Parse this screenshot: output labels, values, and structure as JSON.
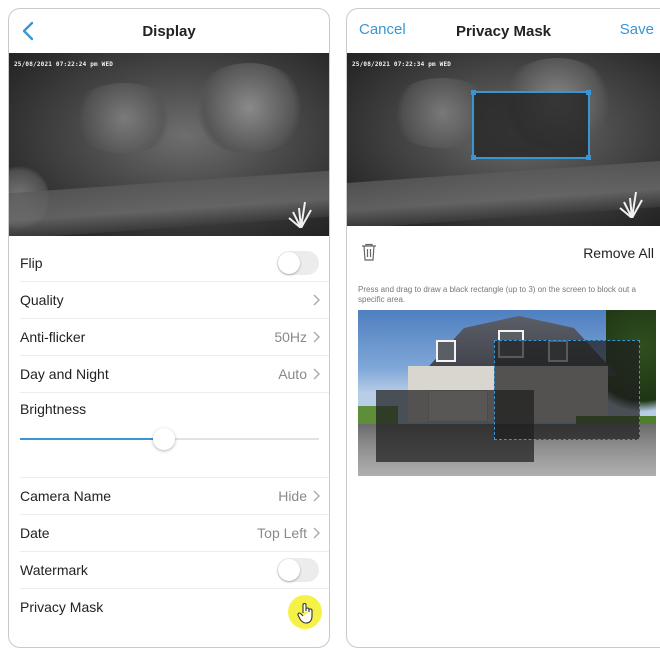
{
  "left_screen": {
    "header": {
      "title": "Display",
      "back_icon": "chevron-left-icon"
    },
    "camera": {
      "timestamp": "25/08/2021 07:22:24 pm WED"
    },
    "settings": {
      "flip": {
        "label": "Flip",
        "toggle_on": false
      },
      "quality": {
        "label": "Quality",
        "value": ""
      },
      "anti_flicker": {
        "label": "Anti-flicker",
        "value": "50Hz"
      },
      "day_night": {
        "label": "Day and Night",
        "value": "Auto"
      },
      "brightness": {
        "label": "Brightness",
        "level_fraction": 0.48
      },
      "camera_name": {
        "label": "Camera Name",
        "value": "Hide"
      },
      "date": {
        "label": "Date",
        "value": "Top Left"
      },
      "watermark": {
        "label": "Watermark",
        "toggle_on": false
      },
      "privacy_mask": {
        "label": "Privacy Mask"
      }
    }
  },
  "right_screen": {
    "header": {
      "cancel_label": "Cancel",
      "title": "Privacy Mask",
      "save_label": "Save"
    },
    "camera": {
      "timestamp": "25/08/2021 07:22:34 pm WED"
    },
    "toolbar": {
      "remove_all_label": "Remove All",
      "trash_icon": "trash-icon"
    },
    "instructions": "Press and drag to draw a black rectangle (up to 3) on the screen to block out a specific area."
  },
  "colors": {
    "accent": "#3a95d6",
    "cursor_highlight": "#f5f03c"
  }
}
